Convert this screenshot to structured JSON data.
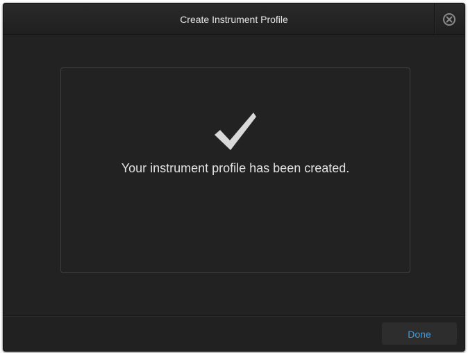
{
  "dialog": {
    "title": "Create Instrument Profile",
    "close_icon": "close-circle-icon",
    "content": {
      "icon": "checkmark-icon",
      "message": "Your instrument profile has been created."
    },
    "footer": {
      "done_label": "Done"
    }
  },
  "colors": {
    "background": "#222222",
    "title_text": "#e6e6e6",
    "accent_blue": "#3c9ee5",
    "checkmark": "#d9d9d9"
  }
}
